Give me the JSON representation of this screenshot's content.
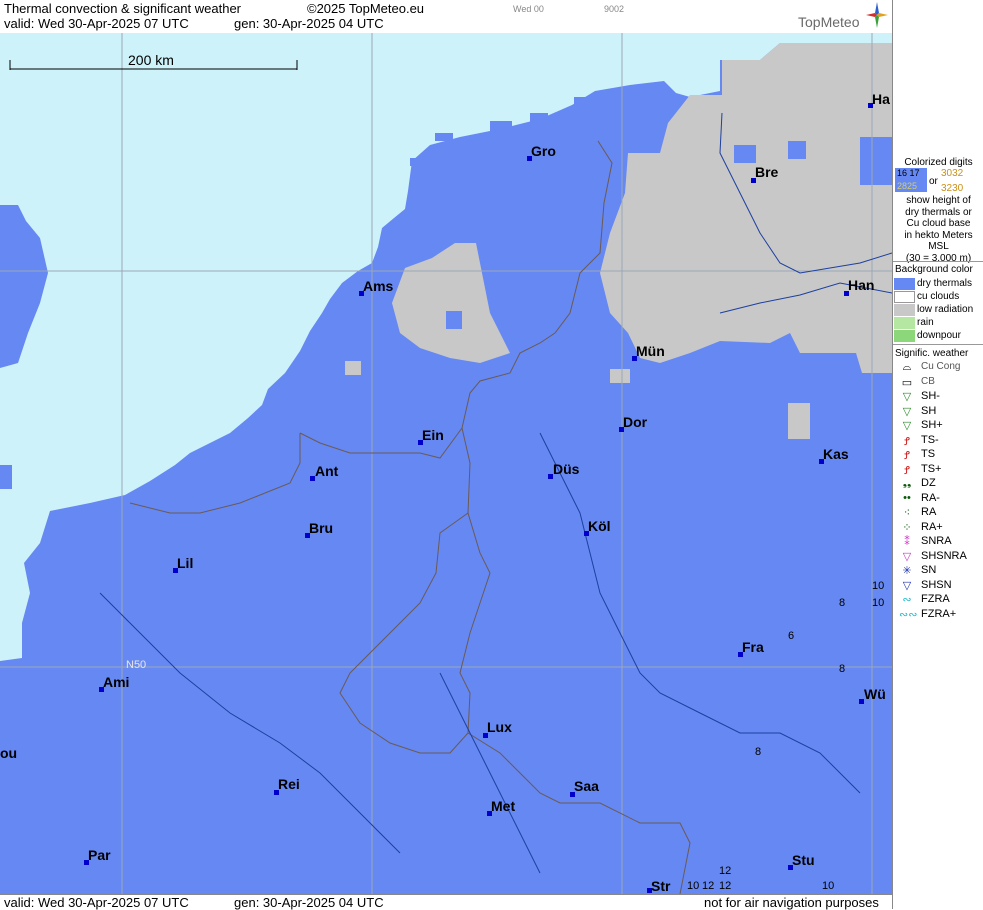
{
  "header": {
    "title": "Thermal convection & significant weather",
    "copyright": "©2025 TopMeteo.eu",
    "run_code": "Wed 00",
    "code2": "9002",
    "valid": "valid:  Wed  30-Apr-2025  07 UTC",
    "gen": "gen: 30-Apr-2025 04 UTC",
    "logo": "TopMeteo"
  },
  "footer": {
    "valid": "valid:  Wed  30-Apr-2025  07 UTC",
    "gen": "gen: 30-Apr-2025 04 UTC",
    "disclaimer": "not for air navigation purposes"
  },
  "scale_bar": {
    "label": "200 km"
  },
  "graticule": {
    "label": "N50"
  },
  "cities": [
    {
      "name": "Gro"
    },
    {
      "name": "Bre"
    },
    {
      "name": "Ha"
    },
    {
      "name": "Ams"
    },
    {
      "name": "Han"
    },
    {
      "name": "Mün"
    },
    {
      "name": "Dor"
    },
    {
      "name": "Ein"
    },
    {
      "name": "Ant"
    },
    {
      "name": "Düs"
    },
    {
      "name": "Kas"
    },
    {
      "name": "Köl"
    },
    {
      "name": "Bru"
    },
    {
      "name": "Lil"
    },
    {
      "name": "Fra"
    },
    {
      "name": "Ami"
    },
    {
      "name": "Wü"
    },
    {
      "name": "Lux"
    },
    {
      "name": "ou"
    },
    {
      "name": "Rei"
    },
    {
      "name": "Saa"
    },
    {
      "name": "Met"
    },
    {
      "name": "Par"
    },
    {
      "name": "Stu"
    },
    {
      "name": "Str"
    }
  ],
  "cloud_base_numbers": [
    "10",
    "8",
    "10",
    "6",
    "8",
    "8",
    "12",
    "10",
    "12",
    "12",
    "10"
  ],
  "legend": {
    "colorized_title": "Colorized digits",
    "digit_samples": [
      "16 17",
      "3032",
      "2825",
      "3230"
    ],
    "or_label": "or",
    "description": [
      "show height of",
      "dry thermals or",
      "Cu cloud base",
      "in hekto Meters",
      "MSL",
      "(30 = 3.000 m)"
    ],
    "background_title": "Background color",
    "background_items": [
      {
        "label": "dry thermals",
        "color": "#6688f2"
      },
      {
        "label": "cu clouds",
        "color": "#ffffff"
      },
      {
        "label": "low radiation",
        "color": "#c8c8c8"
      },
      {
        "label": "rain",
        "color": "#b5e6a2"
      },
      {
        "label": "downpour",
        "color": "#8cd77a"
      }
    ],
    "weather_title": "Signific. weather",
    "weather_items": [
      {
        "label": "Cu Cong",
        "icon": "cu-cong-icon",
        "glyph": "⌓",
        "color": "#000000"
      },
      {
        "label": "CB",
        "icon": "cb-icon",
        "glyph": "▭",
        "color": "#000000"
      },
      {
        "label": "SH-",
        "icon": "shower-light-icon",
        "glyph": "▽",
        "color": "#2a8a2a"
      },
      {
        "label": "SH",
        "icon": "shower-icon",
        "glyph": "▽",
        "color": "#2a8a2a"
      },
      {
        "label": "SH+",
        "icon": "shower-heavy-icon",
        "glyph": "▽",
        "color": "#2a8a2a"
      },
      {
        "label": "TS-",
        "icon": "thunderstorm-light-icon",
        "glyph": "Ꝭ",
        "color": "#cc2020"
      },
      {
        "label": "TS",
        "icon": "thunderstorm-icon",
        "glyph": "Ꝭ",
        "color": "#cc2020"
      },
      {
        "label": "TS+",
        "icon": "thunderstorm-heavy-icon",
        "glyph": "Ꝭ",
        "color": "#cc2020"
      },
      {
        "label": "DZ",
        "icon": "drizzle-icon",
        "glyph": "❟❟",
        "color": "#0a5a0a"
      },
      {
        "label": "RA-",
        "icon": "rain-light-icon",
        "glyph": "••",
        "color": "#0a5a0a"
      },
      {
        "label": "RA",
        "icon": "rain-icon",
        "glyph": "⁖",
        "color": "#0a5a0a"
      },
      {
        "label": "RA+",
        "icon": "rain-heavy-icon",
        "glyph": "⁘",
        "color": "#0a5a0a"
      },
      {
        "label": "SNRA",
        "icon": "snow-rain-icon",
        "glyph": "⁑",
        "color": "#cc33cc"
      },
      {
        "label": "SHSNRA",
        "icon": "snow-rain-shower-icon",
        "glyph": "▽",
        "color": "#cc33cc"
      },
      {
        "label": "SN",
        "icon": "snow-icon",
        "glyph": "✳",
        "color": "#2233aa"
      },
      {
        "label": "SHSN",
        "icon": "snow-shower-icon",
        "glyph": "▽",
        "color": "#2233aa"
      },
      {
        "label": "FZRA",
        "icon": "freezing-rain-icon",
        "glyph": "∾",
        "color": "#22bbcc"
      },
      {
        "label": "FZRA+",
        "icon": "freezing-rain-heavy-icon",
        "glyph": "∾∾",
        "color": "#22bbcc"
      }
    ]
  }
}
